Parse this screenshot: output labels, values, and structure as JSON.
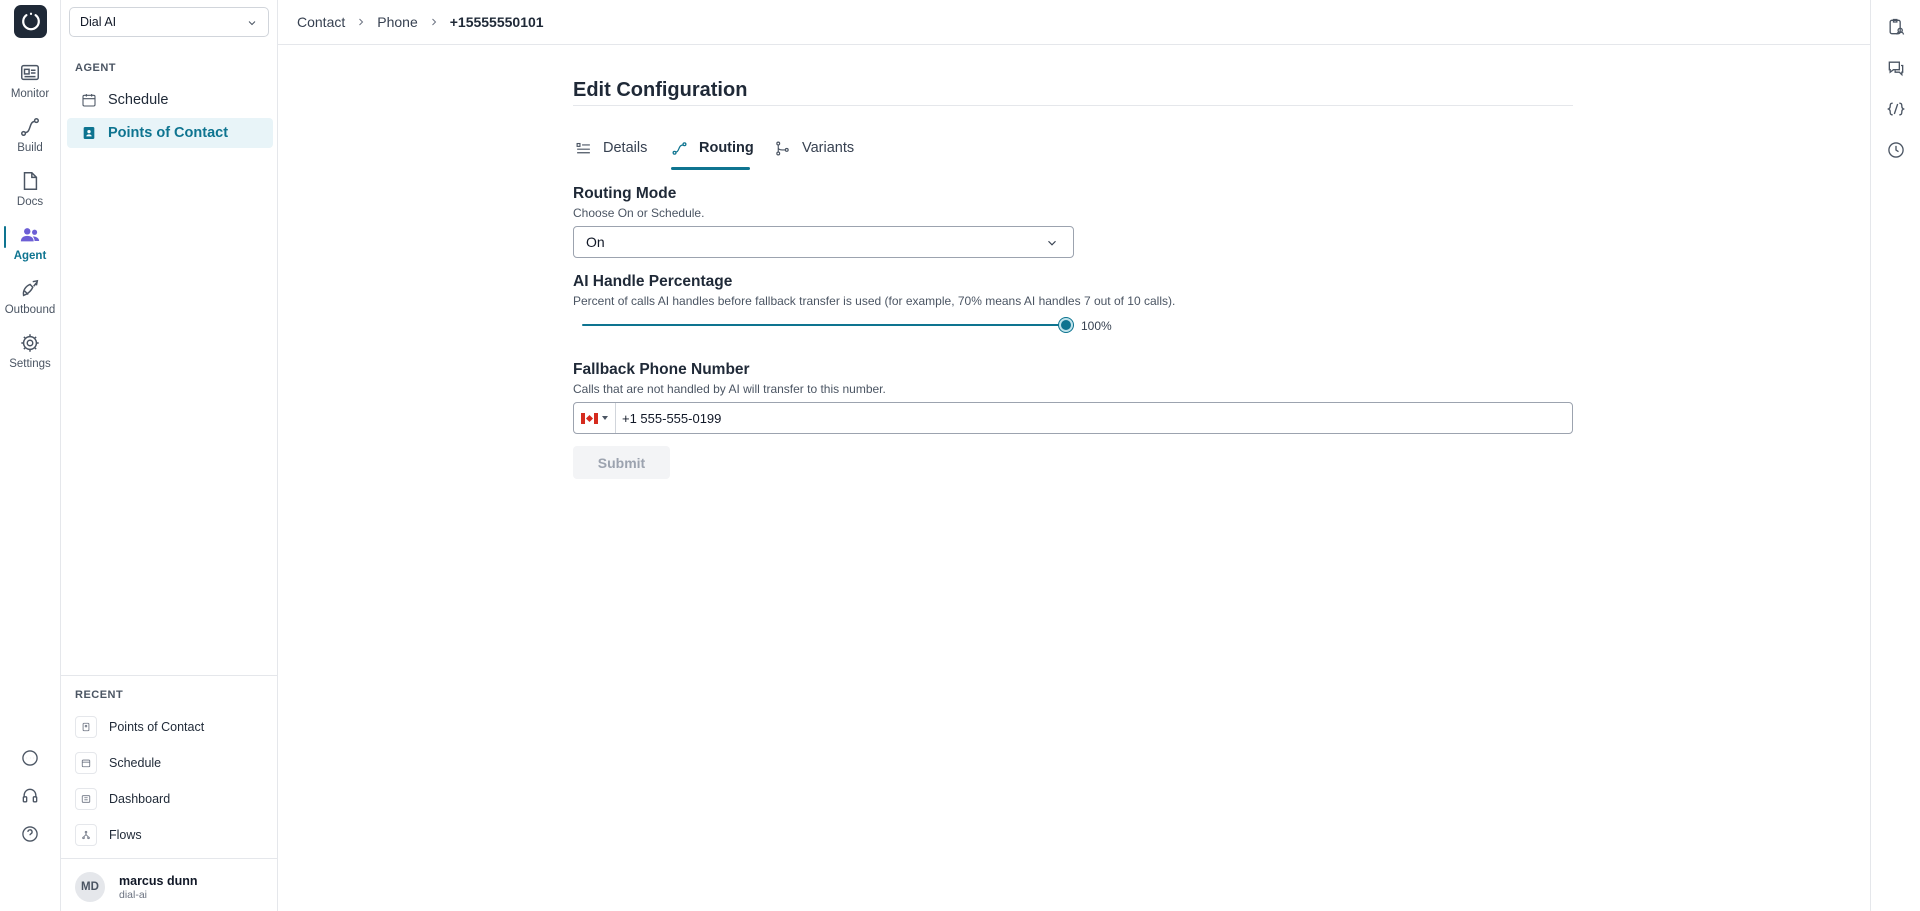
{
  "rail": {
    "items": [
      {
        "label": "Monitor",
        "icon": "monitor-icon"
      },
      {
        "label": "Build",
        "icon": "build-icon"
      },
      {
        "label": "Docs",
        "icon": "docs-icon"
      },
      {
        "label": "Agent",
        "icon": "agent-icon",
        "active": true
      },
      {
        "label": "Outbound",
        "icon": "outbound-icon"
      },
      {
        "label": "Settings",
        "icon": "gear-icon"
      }
    ]
  },
  "workspace": {
    "selected": "Dial AI"
  },
  "sidebar": {
    "section_label": "AGENT",
    "items": [
      {
        "label": "Schedule"
      },
      {
        "label": "Points of Contact",
        "active": true
      }
    ],
    "recent_label": "RECENT",
    "recent": [
      {
        "label": "Points of Contact"
      },
      {
        "label": "Schedule"
      },
      {
        "label": "Dashboard"
      },
      {
        "label": "Flows"
      }
    ]
  },
  "user": {
    "initials": "MD",
    "name": "marcus dunn",
    "org": "dial-ai"
  },
  "breadcrumb": [
    "Contact",
    "Phone",
    "+15555550101"
  ],
  "page": {
    "title": "Edit Configuration"
  },
  "tabs": [
    {
      "label": "Details"
    },
    {
      "label": "Routing",
      "active": true
    },
    {
      "label": "Variants"
    }
  ],
  "routing_mode": {
    "label": "Routing Mode",
    "help": "Choose On or Schedule.",
    "value": "On"
  },
  "ai_handle": {
    "label": "AI Handle Percentage",
    "help": "Percent of calls AI handles before fallback transfer is used (for example, 70% means AI handles 7 out of 10 calls).",
    "value_text": "100%",
    "value": 100
  },
  "fallback": {
    "label": "Fallback Phone Number",
    "help": "Calls that are not handled by AI will transfer to this number.",
    "country": "CA",
    "value": "+1 555-555-0199"
  },
  "submit_label": "Submit",
  "colors": {
    "accent": "#0e7490",
    "active_bg": "#e8f4f8"
  }
}
